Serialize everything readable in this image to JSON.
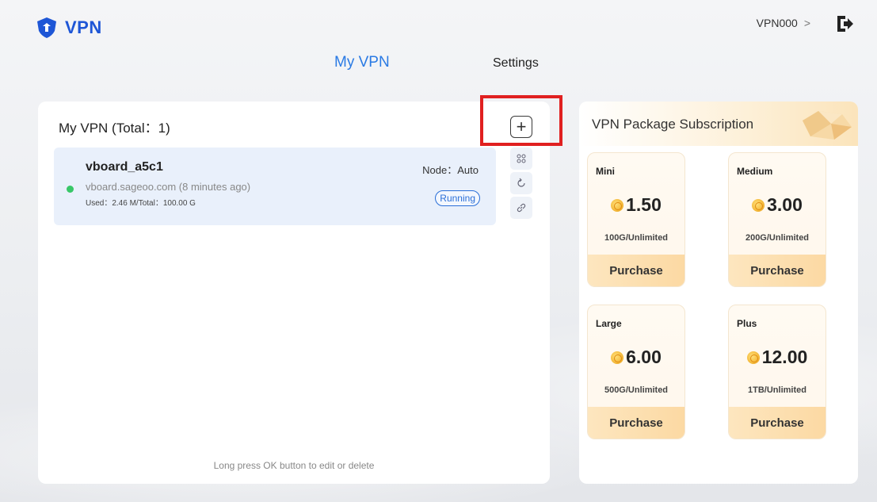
{
  "app": {
    "logo_text": "VPN"
  },
  "user": {
    "name": "VPN000",
    "chevron": ">"
  },
  "nav": {
    "tabs": [
      {
        "label": "My VPN",
        "active": true
      },
      {
        "label": "Settings",
        "active": false
      }
    ]
  },
  "vpn_list": {
    "title": "My VPN (Total：1)",
    "add_label": "+",
    "items": [
      {
        "name": "vboard_a5c1",
        "host": "vboard.sageoo.com  (8 minutes ago)",
        "usage": "Used：2.46 M/Total：100.00 G",
        "node": "Node：Auto",
        "status": "Running",
        "status_color": "#2a6fd8"
      }
    ],
    "hint": "Long press OK button to edit or delete",
    "actions": [
      "settings-icon",
      "refresh-icon",
      "link-icon"
    ]
  },
  "subscription": {
    "title": "VPN Package Subscription",
    "packages": [
      {
        "name": "Mini",
        "price": "1.50",
        "desc": "100G/Unlimited",
        "buy": "Purchase"
      },
      {
        "name": "Medium",
        "price": "3.00",
        "desc": "200G/Unlimited",
        "buy": "Purchase"
      },
      {
        "name": "Large",
        "price": "6.00",
        "desc": "500G/Unlimited",
        "buy": "Purchase"
      },
      {
        "name": "Plus",
        "price": "12.00",
        "desc": "1TB/Unlimited",
        "buy": "Purchase"
      }
    ]
  },
  "colors": {
    "accent": "#2a7ae4",
    "brand": "#1e56d6",
    "highlight": "#e02020",
    "online": "#38c768"
  }
}
